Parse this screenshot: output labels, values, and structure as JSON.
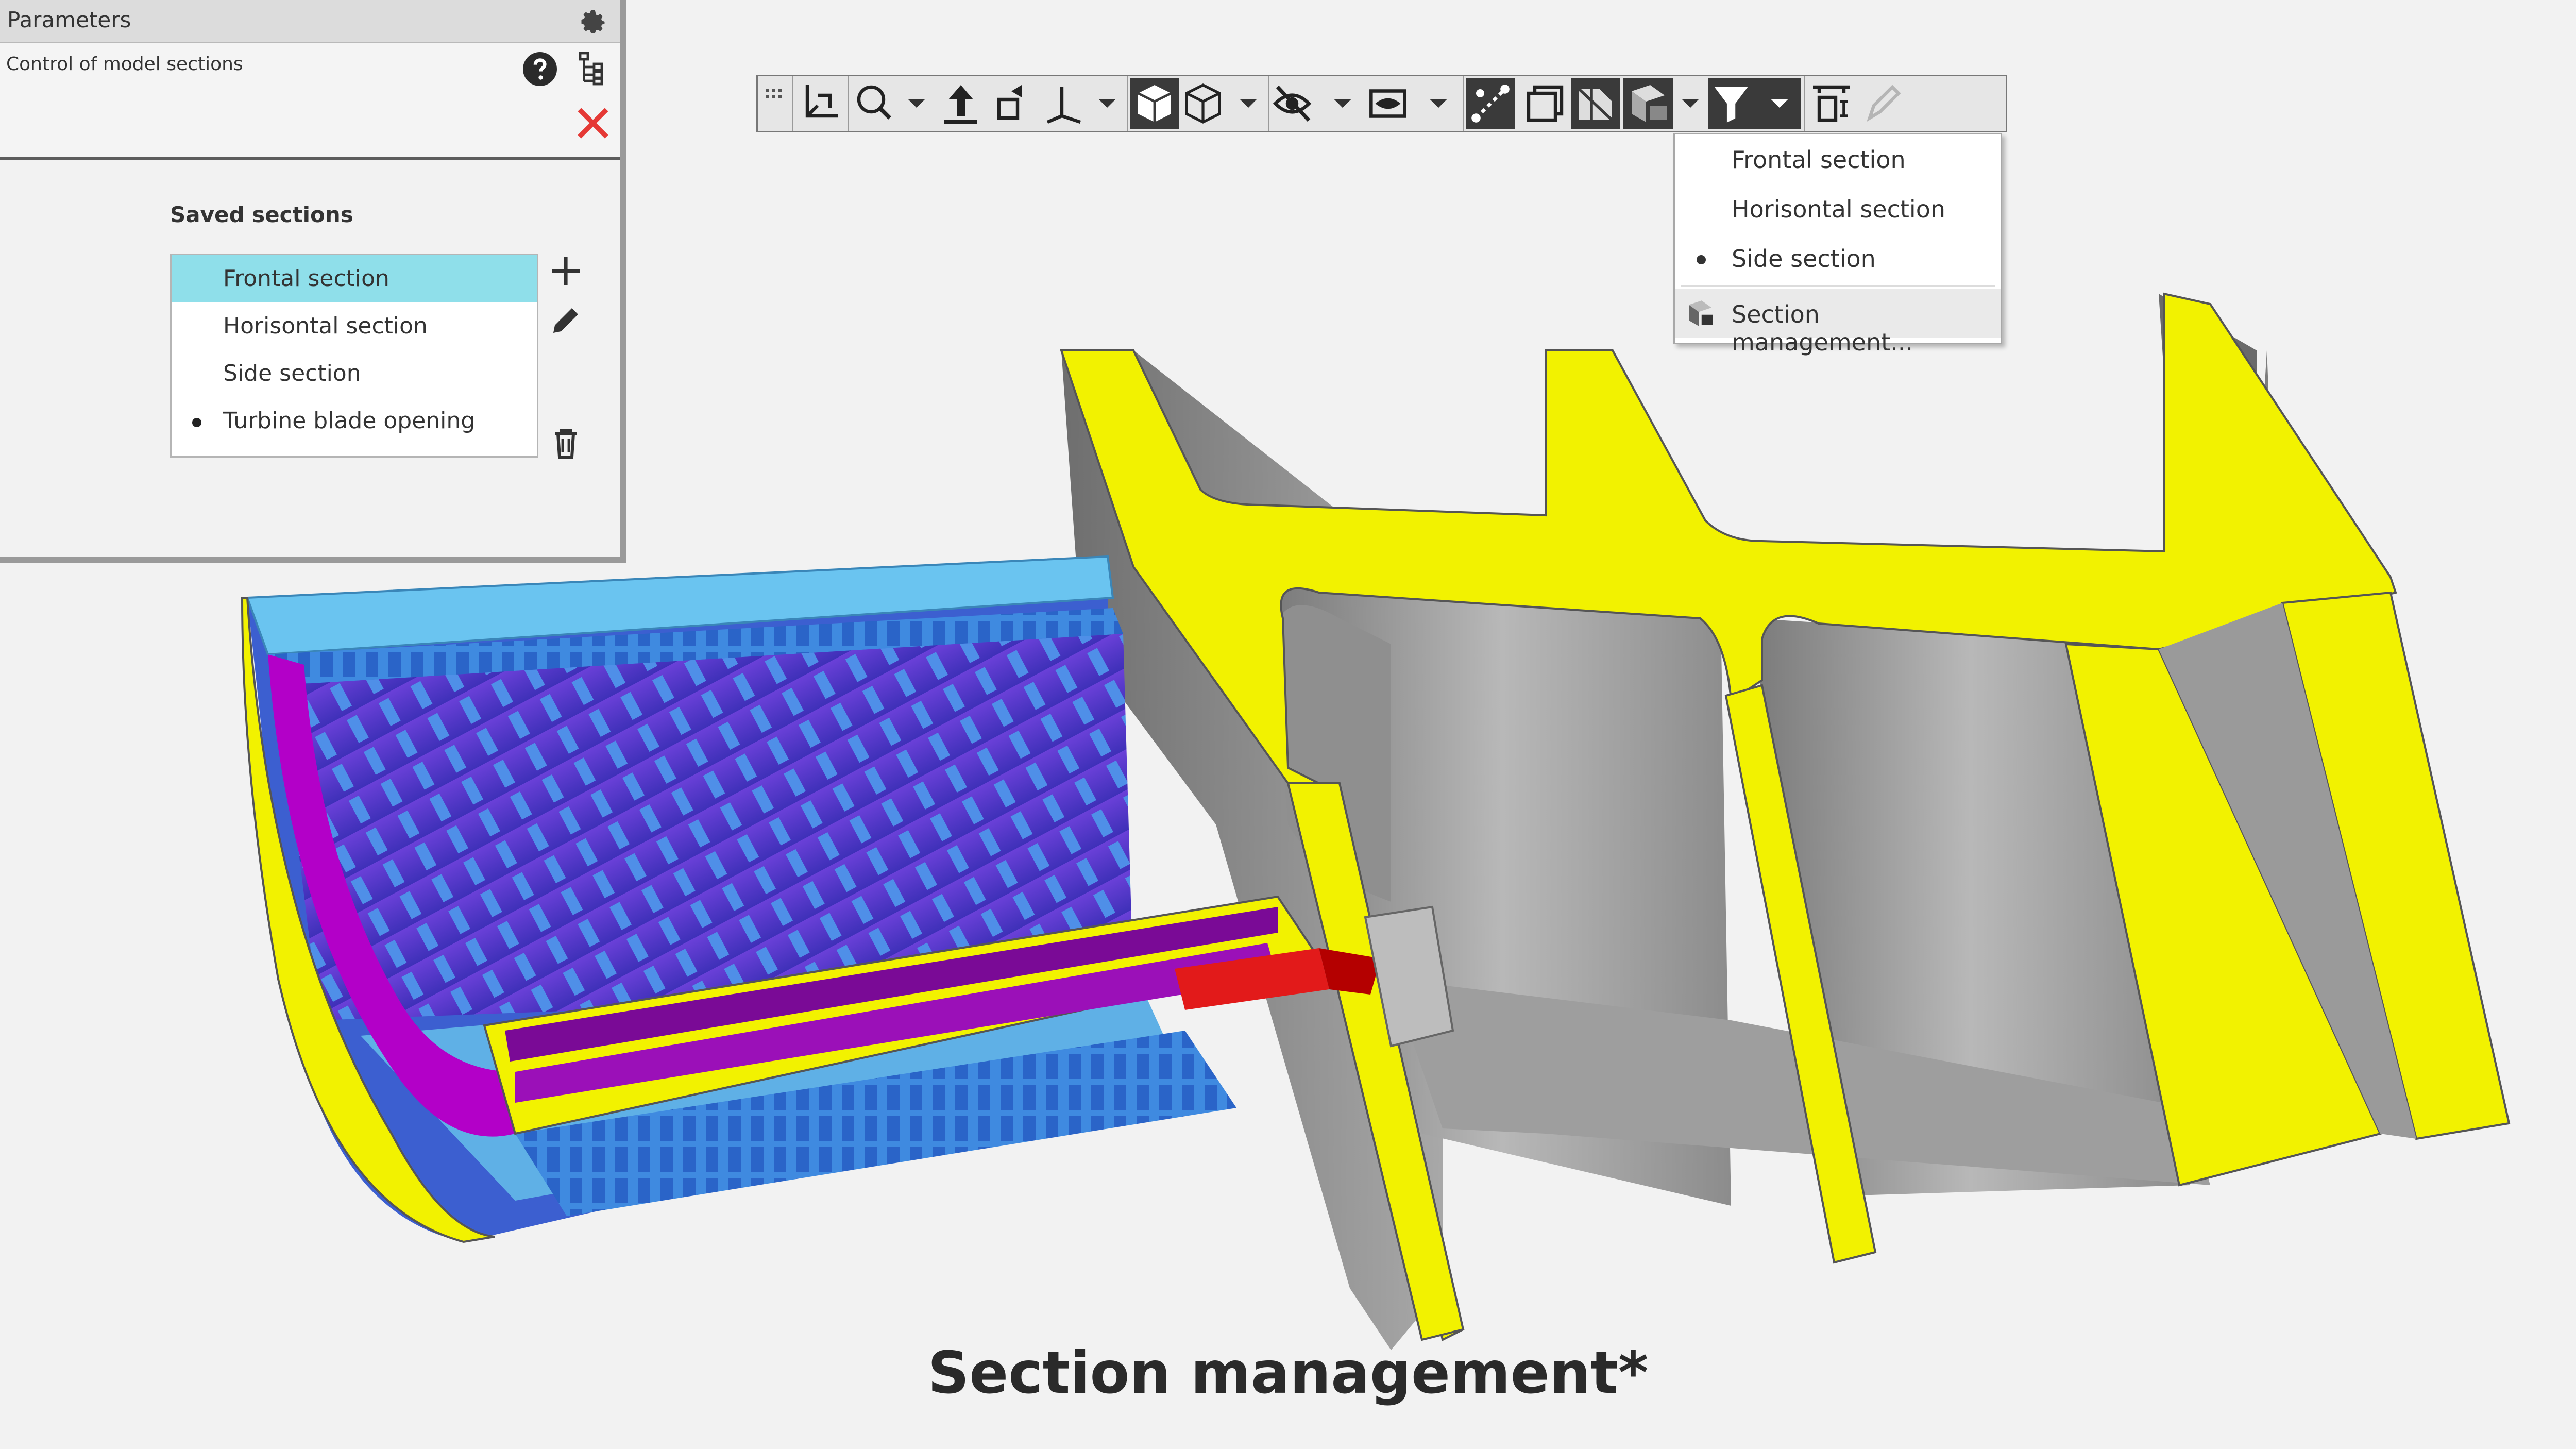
{
  "parameters_panel": {
    "title": "Parameters",
    "subtitle": "Control of model sections",
    "saved_sections_label": "Saved sections",
    "sections": [
      {
        "label": "Frontal section",
        "selected": true,
        "active": false
      },
      {
        "label": "Horisontal section",
        "selected": false,
        "active": false
      },
      {
        "label": "Side section",
        "selected": false,
        "active": false
      },
      {
        "label": "Turbine blade opening",
        "selected": false,
        "active": true
      }
    ],
    "icons": [
      "gear-icon",
      "help-icon",
      "tree-icon",
      "close-icon",
      "add-icon",
      "edit-icon",
      "delete-icon"
    ]
  },
  "toolbar": {
    "icons": [
      "grip-icon",
      "orient-icon",
      "zoom-icon",
      "pan-icon",
      "rotate-icon",
      "axis-icon",
      "shaded-cube-icon",
      "wireframe-cube-icon",
      "hide-icon",
      "show-icon",
      "measure-icon",
      "layers-icon",
      "transparency-icon",
      "section-icon",
      "filter-icon",
      "dimension-icon",
      "pen-icon"
    ]
  },
  "section_dropdown": {
    "items": [
      {
        "label": "Frontal section",
        "active": false
      },
      {
        "label": "Horisontal section",
        "active": false
      },
      {
        "label": "Side section",
        "active": true
      }
    ],
    "manage_label": "Section management..."
  },
  "caption": "Section management*",
  "colors": {
    "highlight": "#8fdfea",
    "section_yellow": "#f2f200",
    "close_red": "#e53935",
    "magenta": "#b300c8",
    "blue": "#2f72e6"
  }
}
